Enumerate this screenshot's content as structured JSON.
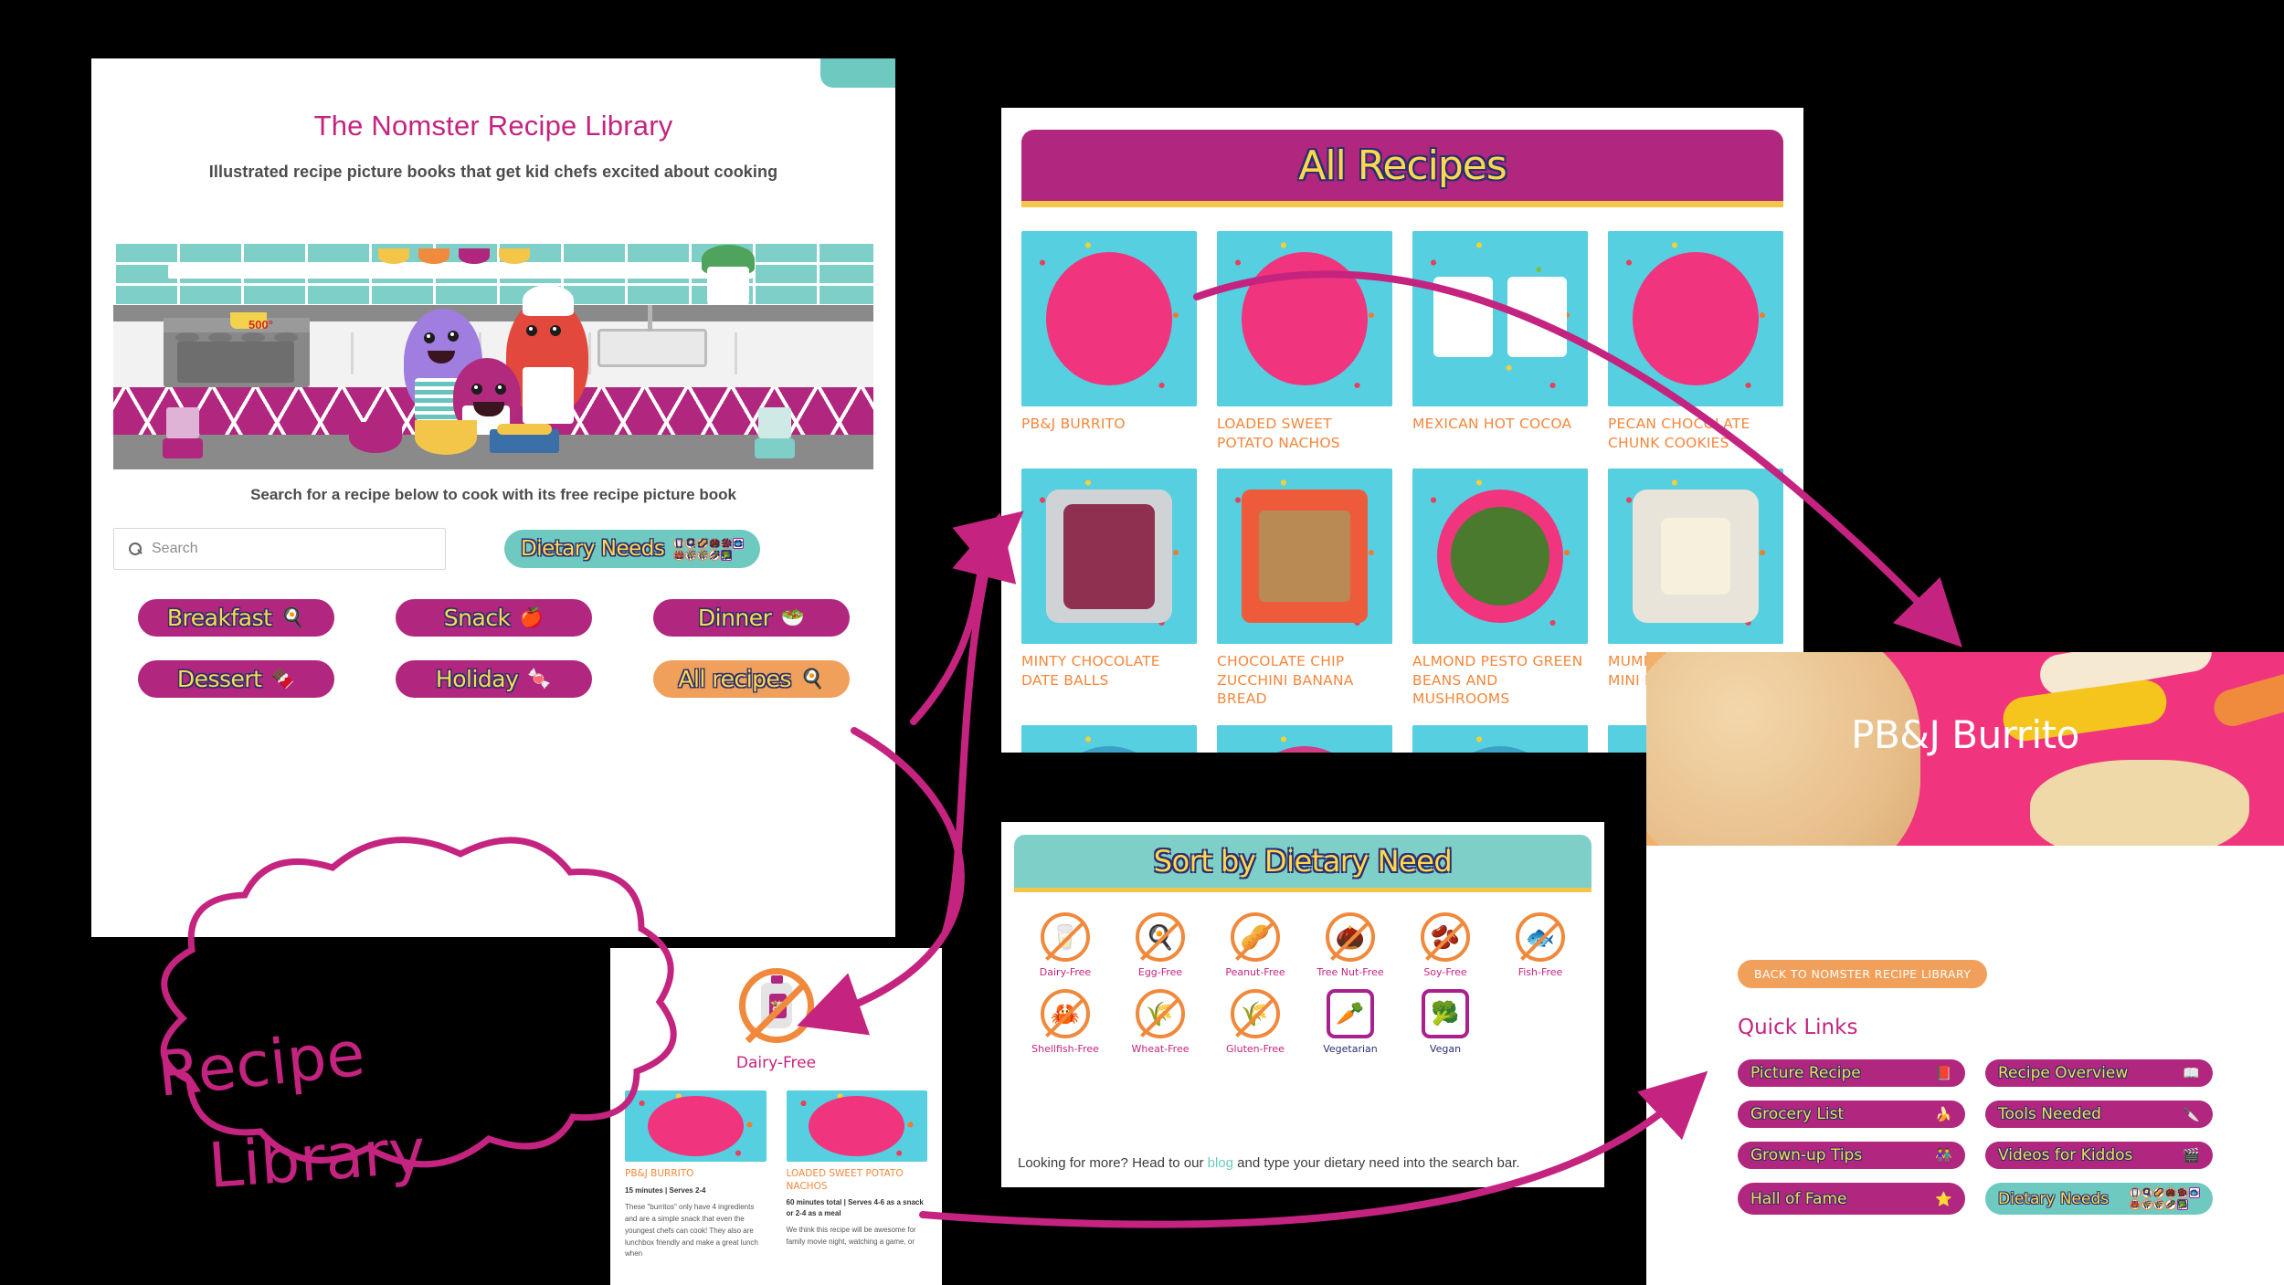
{
  "library": {
    "title": "The Nomster Recipe Library",
    "subtitle": "Illustrated recipe picture books that get kid chefs excited about cooking",
    "stove_temp": "500°",
    "search_note": "Search for a recipe below to cook with its free recipe picture book",
    "search": {
      "placeholder": "Search",
      "value": "",
      "icon": "search-icon"
    },
    "dietary_button": {
      "label": "Dietary Needs",
      "icon": "dietary-icons-strip",
      "color": "#6ec9c0"
    },
    "categories": [
      {
        "label": "Breakfast",
        "emoji": "🍳",
        "color": "#b1267e"
      },
      {
        "label": "Snack",
        "emoji": "🍎",
        "color": "#b1267e"
      },
      {
        "label": "Dinner",
        "emoji": "🥗",
        "color": "#b1267e"
      },
      {
        "label": "Dessert",
        "emoji": "🍫",
        "color": "#b1267e"
      },
      {
        "label": "Holiday",
        "emoji": "🍬",
        "color": "#b1267e"
      },
      {
        "label": "All recipes",
        "emoji": "🍳",
        "color": "#f0a05a"
      }
    ]
  },
  "all_recipes": {
    "heading": "All Recipes",
    "heading_bg": "#b1267e",
    "heading_text_color": "#ffd84d",
    "rule_color": "#f3c64a",
    "items": [
      {
        "name": "PB&J BURRITO",
        "plate": "#f0357e"
      },
      {
        "name": "LOADED SWEET POTATO NACHOS",
        "plate": "#f0357e"
      },
      {
        "name": "MEXICAN HOT COCOA",
        "plate": "#ffffff"
      },
      {
        "name": "PECAN CHOCOLATE CHUNK COOKIES",
        "plate": "#f0357e"
      },
      {
        "name": "MINTY CHOCOLATE DATE BALLS",
        "plate": "#cfd3d6"
      },
      {
        "name": "CHOCOLATE CHIP ZUCCHINI BANANA BREAD",
        "plate": "#ee5b3b"
      },
      {
        "name": "ALMOND PESTO GREEN BEANS AND MUSHROOMS",
        "plate": "#f0357e"
      },
      {
        "name": "MUMMY CAULIFLOWER MINI PIZZAS",
        "plate": "#e8e4da"
      },
      {
        "name": "",
        "plate": "#3aa0c4"
      },
      {
        "name": "",
        "plate": "#d63b86"
      },
      {
        "name": "",
        "plate": "#3aa0c4"
      },
      {
        "name": "",
        "plate": "#f0357e"
      }
    ]
  },
  "dietary_panel": {
    "heading": "Sort by Dietary Need",
    "heading_bg": "#7ecfc7",
    "needs": [
      {
        "label": "Dairy-Free",
        "emoji": "🥛",
        "shape": "circle"
      },
      {
        "label": "Egg-Free",
        "emoji": "🍳",
        "shape": "circle"
      },
      {
        "label": "Peanut-Free",
        "emoji": "🥜",
        "shape": "circle"
      },
      {
        "label": "Tree Nut-Free",
        "emoji": "🌰",
        "shape": "circle"
      },
      {
        "label": "Soy-Free",
        "emoji": "🫘",
        "shape": "circle"
      },
      {
        "label": "Fish-Free",
        "emoji": "🐟",
        "shape": "circle"
      },
      {
        "label": "Shellfish-Free",
        "emoji": "🦀",
        "shape": "circle"
      },
      {
        "label": "Wheat-Free",
        "emoji": "🌾",
        "shape": "circle"
      },
      {
        "label": "Gluten-Free",
        "emoji": "🌾",
        "shape": "circle"
      },
      {
        "label": "Vegetarian",
        "emoji": "🥕",
        "shape": "box"
      },
      {
        "label": "Vegan",
        "emoji": "🥦",
        "shape": "box"
      }
    ],
    "footer_before": "Looking for more? Head to our ",
    "footer_link": "blog",
    "footer_after": " and type your dietary need into the search bar."
  },
  "dairy_free_panel": {
    "icon_label": "Dairy-Free",
    "recipes": [
      {
        "name": "PB&J BURRITO",
        "meta": "15 minutes | Serves 2-4",
        "desc": "These \"burritos\" only have 4 ingredients and are a simple snack that even the youngest chefs can cook! They also are lunchbox friendly and make a great lunch when"
      },
      {
        "name": "LOADED SWEET POTATO NACHOS",
        "meta": "60 minutes total | Serves 4-6 as a snack or 2-4 as a meal",
        "desc": "We think this recipe will be awesome for family movie night, watching a game, or"
      }
    ]
  },
  "recipe_page": {
    "hero_title": "PB&J Burrito",
    "back_button": "BACK TO NOMSTER RECIPE LIBRARY",
    "quick_links_title": "Quick Links",
    "quick_links": [
      {
        "label": "Picture Recipe",
        "emoji": "📕",
        "color": "#b1267e"
      },
      {
        "label": "Recipe Overview",
        "emoji": "📖",
        "color": "#b1267e"
      },
      {
        "label": "Grocery List",
        "emoji": "🍌",
        "color": "#b1267e"
      },
      {
        "label": "Tools Needed",
        "emoji": "🔪",
        "color": "#b1267e"
      },
      {
        "label": "Grown-up Tips",
        "emoji": "👫",
        "color": "#b1267e"
      },
      {
        "label": "Videos for Kiddos",
        "emoji": "🎬",
        "color": "#b1267e"
      },
      {
        "label": "Hall of Fame",
        "emoji": "⭐",
        "color": "#b1267e"
      },
      {
        "label": "Dietary Needs",
        "emoji": "",
        "color": "#6ec9c0"
      }
    ]
  },
  "annotation": {
    "handwritten_label": "Recipe Library",
    "ink_color": "#c4247f"
  }
}
